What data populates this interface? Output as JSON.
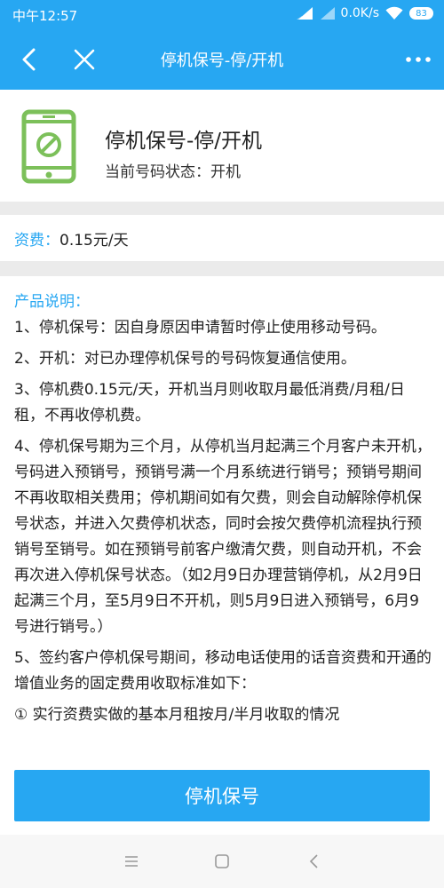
{
  "status_bar": {
    "time": "中午12:57",
    "net_speed": "0.0K/s",
    "battery_level": "83"
  },
  "navbar": {
    "title": "停机保号-停/开机"
  },
  "service": {
    "name": "停机保号-停/开机",
    "status_text": "当前号码状态：开机"
  },
  "fee": {
    "label": "资费：",
    "value": "0.15元/天"
  },
  "description": {
    "heading": "产品说明：",
    "paragraphs": [
      "1、停机保号：因自身原因申请暂时停止使用移动号码。",
      "2、开机：对已办理停机保号的号码恢复通信使用。",
      "3、停机费0.15元/天，开机当月则收取月最低消费/月租/日租，不再收停机费。",
      "4、停机保号期为三个月，从停机当月起满三个月客户未开机，号码进入预销号，预销号满一个月系统进行销号；预销号期间不再收取相关费用；停机期间如有欠费，则会自动解除停机保号状态，并进入欠费停机状态，同时会按欠费停机流程执行预销号至销号。如在预销号前客户缴清欠费，则自动开机，不会再次进入停机保号状态。（如2月9日办理营销停机，从2月9日起满三个月，至5月9日不开机，则5月9日进入预销号，6月9号进行销号。）",
      "5、签约客户停机保号期间，移动电话使用的话音资费和开通的增值业务的固定费用收取标准如下：",
      "① 实行资费实做的基本月租按月/半月收取的情况"
    ]
  },
  "action": {
    "button_label": "停机保号"
  },
  "colors": {
    "accent": "#27a7f2",
    "icon_green": "#7cc05a"
  }
}
